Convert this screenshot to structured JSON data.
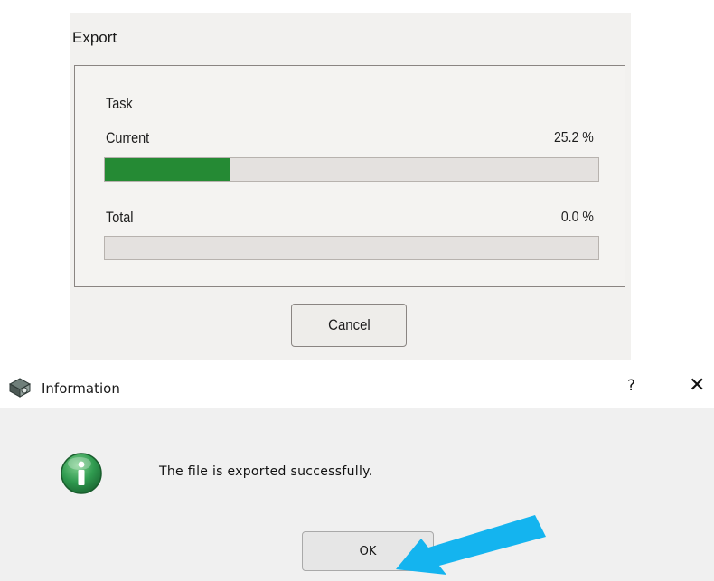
{
  "export_dialog": {
    "title": "Export",
    "task_label": "Task",
    "current": {
      "label": "Current",
      "value_text": "25.2 %",
      "progress": 0.252
    },
    "total": {
      "label": "Total",
      "value_text": "0.0 %",
      "progress": 0.0
    },
    "cancel_label": "Cancel",
    "progress_color": "#258a34"
  },
  "info_dialog": {
    "title": "Information",
    "help_label": "?",
    "close_label": "✕",
    "message": "The file is exported successfully.",
    "ok_label": "OK",
    "icon": "info-icon",
    "app_icon": "app-icon"
  },
  "annotation": {
    "icon": "arrow-icon",
    "color": "#14b4ef"
  }
}
